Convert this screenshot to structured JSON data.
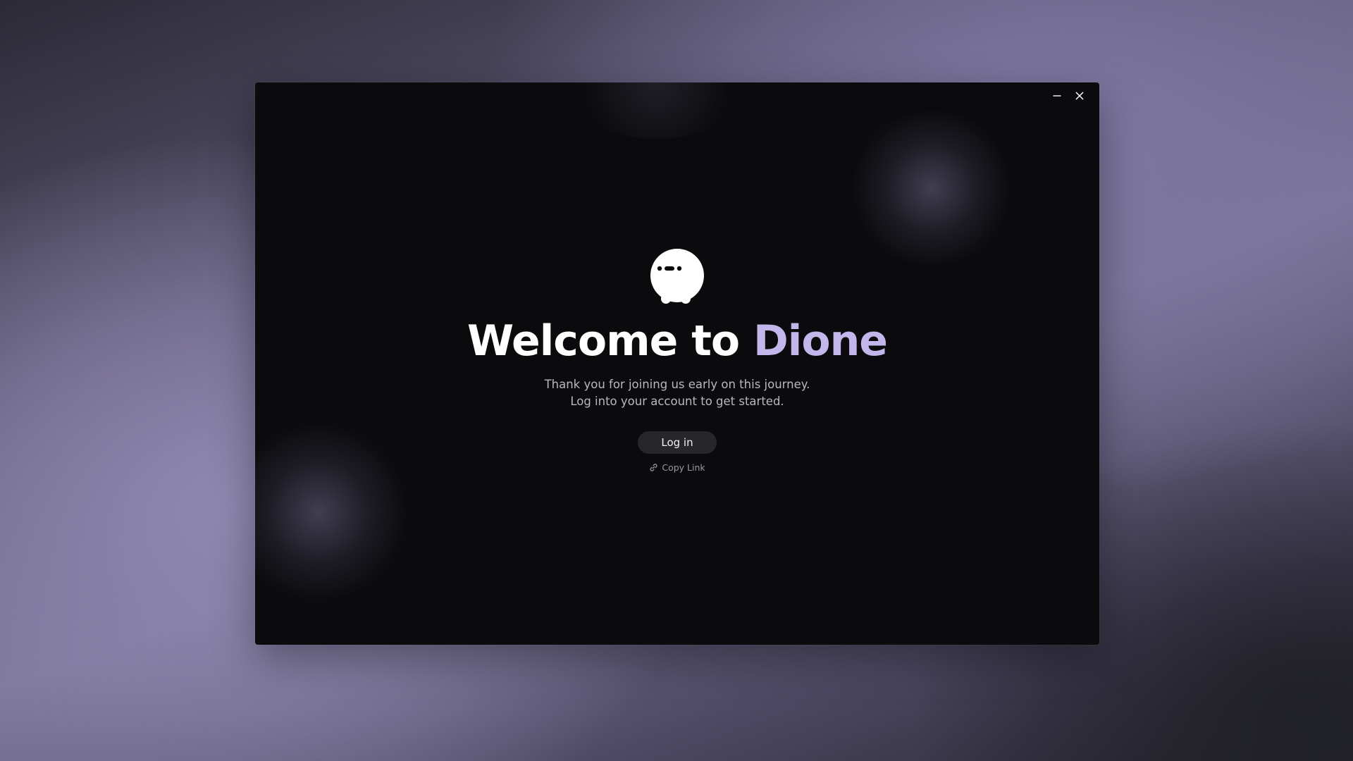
{
  "window": {
    "controls": {
      "minimize_icon": "minimize-icon",
      "close_icon": "close-icon"
    }
  },
  "welcome": {
    "mascot_icon": "dione-mascot-icon",
    "headline_prefix": "Welcome to ",
    "headline_brand": "Dione",
    "subtitle_line1": "Thank you for joining us early on this journey.",
    "subtitle_line2": "Log into your account to get started.",
    "login_label": "Log in",
    "copy_link_label": "Copy Link",
    "copy_link_icon": "link-icon"
  },
  "colors": {
    "window_background": "#0b0b0e",
    "accent": "#c2b6ea",
    "button_background": "#26262b",
    "text_primary": "#ffffff",
    "text_secondary": "#b8b8c0"
  }
}
